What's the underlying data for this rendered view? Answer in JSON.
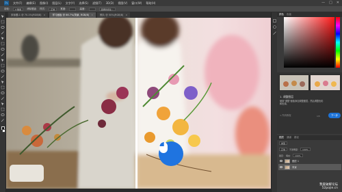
{
  "app": {
    "logo": "Ps",
    "menu": [
      "文件(F)",
      "编辑(E)",
      "图像(I)",
      "图层(L)",
      "文字(Y)",
      "选择(S)",
      "滤镜(T)",
      "3D(D)",
      "视图(V)",
      "窗口(W)",
      "帮助(H)"
    ],
    "window_controls": [
      "—",
      "□",
      "✕"
    ]
  },
  "options_bar": {
    "feather_label": "羽化:",
    "feather_value": "0 像素",
    "antialias_label": "消除锯齿",
    "style_label": "样式:",
    "style_value": "正常",
    "width_label": "宽度:",
    "height_label": "高度:",
    "select_mask_button": "选择并遮住..."
  },
  "tabs": [
    {
      "label": "未标题-1 @ 70.1%(RGB/8)",
      "active": false
    },
    {
      "label": "学习面板 @ 66.7%(背景, RGB/8)",
      "active": true
    },
    {
      "label": "照片 @ 50%(RGB/8)",
      "active": false
    }
  ],
  "tools": [
    "move-tool-icon",
    "marquee-tool-icon",
    "lasso-tool-icon",
    "magic-wand-icon",
    "crop-tool-icon",
    "eyedropper-icon",
    "healing-brush-icon",
    "brush-tool-icon",
    "clone-stamp-icon",
    "history-brush-icon",
    "eraser-tool-icon",
    "gradient-tool-icon",
    "blur-tool-icon",
    "dodge-tool-icon",
    "pen-tool-icon",
    "type-tool-icon",
    "path-select-icon",
    "shape-tool-icon",
    "hand-tool-icon",
    "zoom-tool-icon"
  ],
  "panels": {
    "top_tabs": [
      "颜色",
      "色板"
    ],
    "learn": {
      "title": "1. 调整图层",
      "text": "使用\"调整\"面板添加调整图层，然后调整色彩和色调。",
      "back_link": "< 所有教程",
      "page": "1/5",
      "next_button": "下一步"
    },
    "layers": {
      "tabs": [
        "图层",
        "通道",
        "路径"
      ],
      "kind_label": "类型",
      "blend_mode": "正常",
      "opacity_label": "不透明度:",
      "opacity_value": "100%",
      "lock_label": "锁定:",
      "fill_label": "填充:",
      "fill_value": "100%",
      "rows": [
        {
          "name": "图层 1",
          "selected": false
        },
        {
          "name": "背景",
          "selected": true
        }
      ]
    }
  },
  "colors": {
    "accent": "#1e73d7",
    "panel_bg": "#3a3a3a",
    "menubar_bg": "#3a3a3a"
  },
  "canvas": {
    "comparison_handle_icon": "mouse-icon"
  },
  "watermark": {
    "line1": "我爱破解论坛",
    "line2": "52pojie.cn"
  }
}
